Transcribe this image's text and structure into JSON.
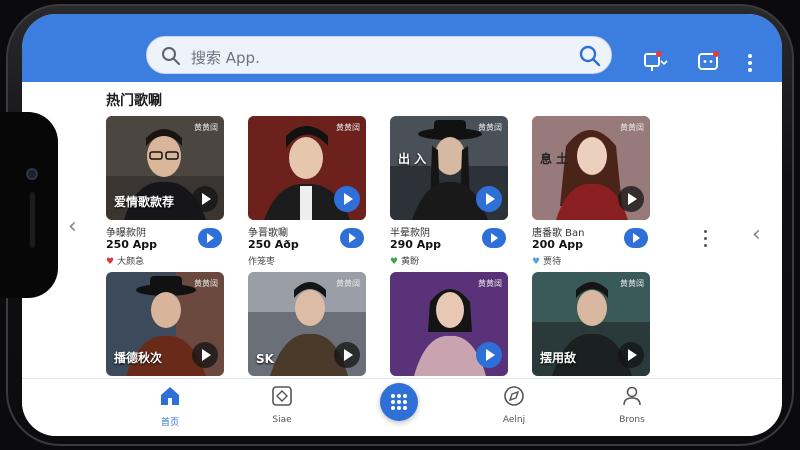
{
  "search": {
    "placeholder": "搜索 App."
  },
  "section": {
    "title": "热门歌唰"
  },
  "colors": {
    "brand": "#3b7ee0",
    "accent": "#2f6fd8"
  },
  "cards_row1": [
    {
      "badge": "黄黄阔",
      "overlay": "爱情歌款荐",
      "name": "争曝款阴",
      "count": "250 App",
      "tag": "大颜急",
      "tag_color": "#d93a3a",
      "icon": "heart-icon"
    },
    {
      "badge": "黄黄阔",
      "overlay": "",
      "name": "争晋歌唰",
      "count": "250 Aðp",
      "tag": "作笼枣",
      "tag_color": "",
      "icon": ""
    },
    {
      "badge": "黄黄阔",
      "overlay": "出 入",
      "name": "半晕款阴",
      "count": "290 App",
      "tag": "黄盼",
      "tag_color": "#3aa64a",
      "icon": "heart-icon"
    },
    {
      "badge": "黄黄阔",
      "overlay": "息 土",
      "name": "唐番歌 Ban",
      "count": "200 App",
      "tag": "贾待",
      "tag_color": "#5aa0e0",
      "icon": "heart-icon"
    }
  ],
  "cards_row2": [
    {
      "badge": "黄黄阔",
      "overlay": "播德秋次"
    },
    {
      "badge": "黄黄阔",
      "overlay": "SK"
    },
    {
      "badge": "黄黄阔",
      "overlay": ""
    },
    {
      "badge": "黄黄阔",
      "overlay": "摆用敌"
    }
  ],
  "nav": {
    "home": "首页",
    "second": "Siae",
    "fourth": "Aelnj",
    "fifth": "Brons"
  }
}
